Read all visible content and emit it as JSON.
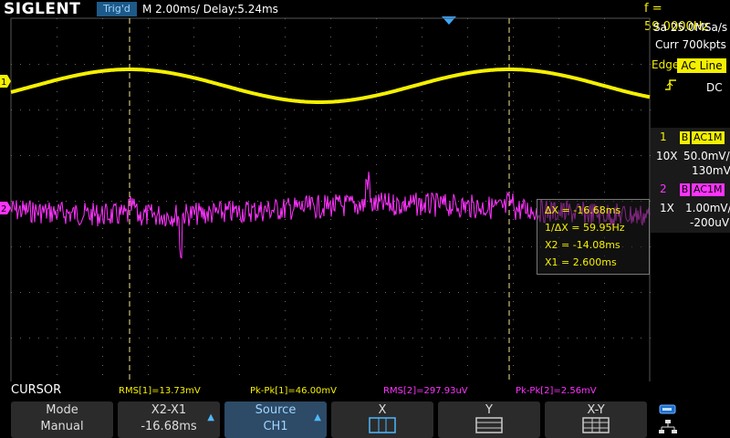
{
  "top": {
    "logo": "SIGLENT",
    "trig_status": "Trig'd",
    "timebase": "M 2.00ms/ Delay:5.24ms",
    "frequency": "f = 59.0000Hz"
  },
  "right_panel": {
    "sample_rate": "Sa 25.0MSa/s",
    "memory_depth": "Curr 700kpts",
    "trigger_type": "Edge",
    "trigger_source": "AC Line",
    "trigger_coupling": "DC",
    "channels": [
      {
        "num": "1",
        "bw": "B",
        "coupling": "AC1M",
        "probe": "10X",
        "scale": "50.0mV/",
        "offset": "130mV",
        "color": "#f5f000"
      },
      {
        "num": "2",
        "bw": "B",
        "coupling": "AC1M",
        "probe": "1X",
        "scale": "1.00mV/",
        "offset": "-200uV",
        "color": "#ff33ff"
      }
    ]
  },
  "markers": {
    "ch1": "1",
    "ch2": "2"
  },
  "cursor_info": {
    "dx": "ΔX = -16.68ms",
    "inv_dx": "1/ΔX = 59.95Hz",
    "x2": "X2 = -14.08ms",
    "x1": "X1 = 2.600ms"
  },
  "measurements": {
    "rms1": "RMS[1]=13.73mV",
    "pkpk1": "Pk-Pk[1]=46.00mV",
    "rms2": "RMS[2]=297.93uV",
    "pkpk2": "Pk-Pk[2]=2.56mV"
  },
  "menu": {
    "title": "CURSOR",
    "mode_label": "Mode",
    "mode_value": "Manual",
    "x2x1_label": "X2-X1",
    "x2x1_value": "-16.68ms",
    "source_label": "Source",
    "source_value": "CH1",
    "x_label": "X",
    "y_label": "Y",
    "xy_label": "X-Y"
  },
  "colors": {
    "ch1": "#f5f000",
    "ch2": "#ff33ff",
    "cursor": "#f5e68c",
    "accent": "#4db8ff"
  },
  "icons": {
    "trigger_edge": "rising-edge-icon",
    "trigger_pos": "trigger-position-icon",
    "usb": "usb-icon",
    "network": "network-icon"
  }
}
